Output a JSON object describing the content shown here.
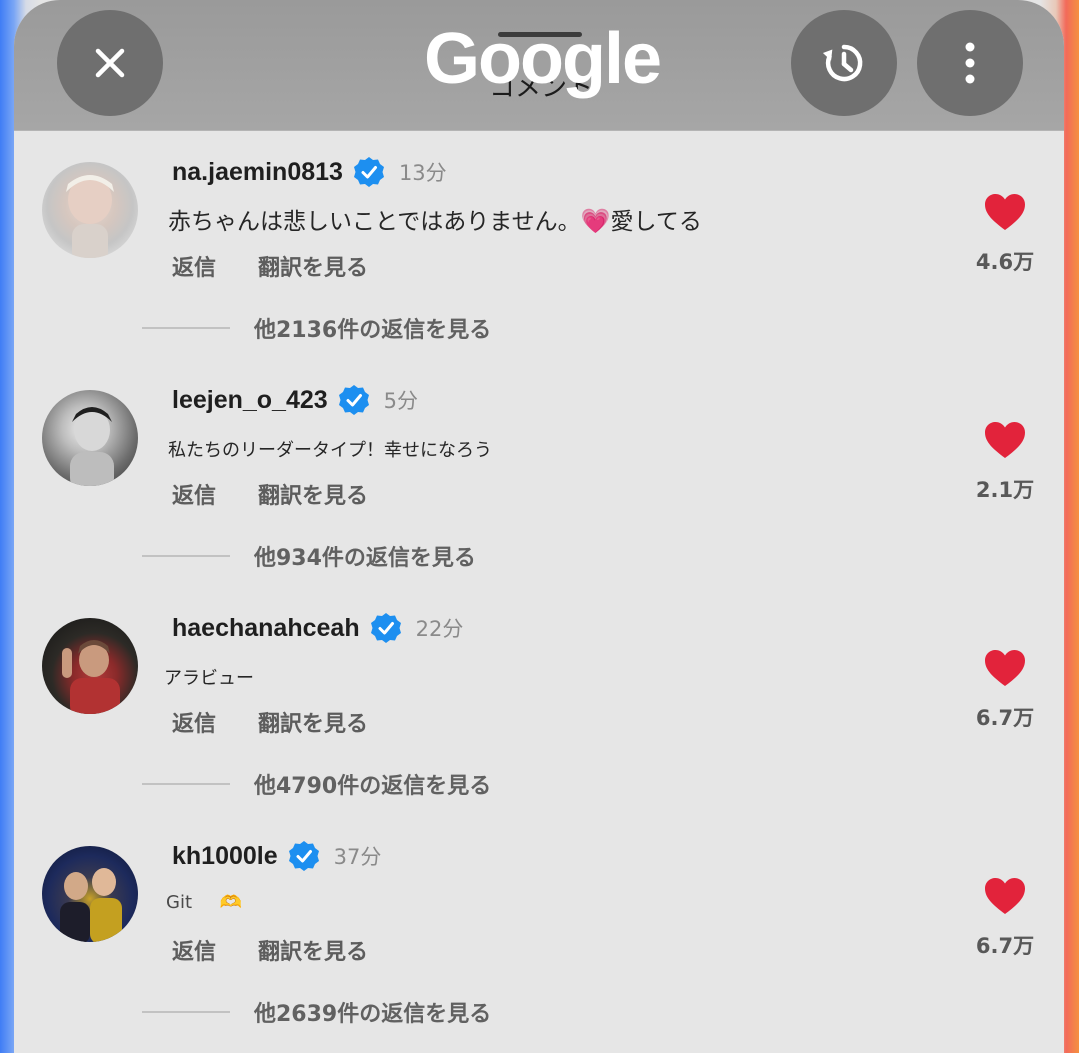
{
  "header": {
    "logo_text": "Google",
    "title": "コメント"
  },
  "colors": {
    "like_red": "#e2233b",
    "verified_blue": "#1d8ff0",
    "left_edge": "#3f7df5",
    "right_edge": "#f26a5a"
  },
  "icons": {
    "close": "close-icon",
    "history": "history-icon",
    "more": "more-vert-icon",
    "verified": "verified-badge-icon",
    "like": "heart-icon"
  },
  "comments": [
    {
      "username": "na.jaemin0813",
      "time": "13分",
      "text": "赤ちゃんは悲しいことではありません。",
      "emoji": "💗",
      "text_after": "愛してる",
      "reply_label": "返信",
      "translate_label": "翻訳を見る",
      "like_count": "4.6万",
      "more_replies": "他2136件の返信を見る"
    },
    {
      "username": "leejen_o_423",
      "time": "5分",
      "text": "私たちのリーダータイプ！幸せになろう",
      "emoji": "",
      "text_after": "",
      "reply_label": "返信",
      "translate_label": "翻訳を見る",
      "like_count": "2.1万",
      "more_replies": "他934件の返信を見る"
    },
    {
      "username": "haechanahceah",
      "time": "22分",
      "text": "アラビュー",
      "emoji": "",
      "text_after": "",
      "reply_label": "返信",
      "translate_label": "翻訳を見る",
      "like_count": "6.7万",
      "more_replies": "他4790件の返信を見る"
    },
    {
      "username": "kh1000le",
      "time": "37分",
      "text": "Git",
      "emoji": "🫶",
      "text_after": "",
      "reply_label": "返信",
      "translate_label": "翻訳を見る",
      "like_count": "6.7万",
      "more_replies": "他2639件の返信を見る"
    }
  ]
}
